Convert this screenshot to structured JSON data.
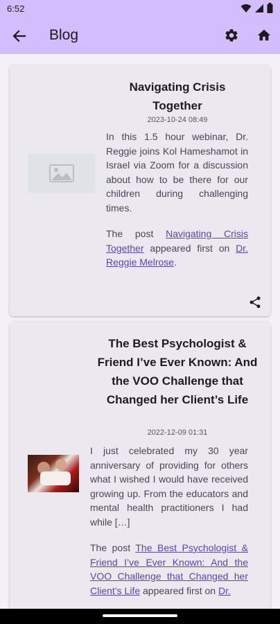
{
  "status_bar": {
    "time": "6:52"
  },
  "app_bar": {
    "title": "Blog"
  },
  "posts": [
    {
      "title": "Navigating Crisis Together",
      "date": "2023-10-24 08:49",
      "excerpt": "In this 1.5 hour webinar, Dr. Reggie joins Kol Hameshamot in Israel via Zoom for a discussion about how to be there for our children during challenging times.",
      "footer_prefix": "The post",
      "footer_link_post": "Navigating Crisis Together",
      "footer_middle": "appeared first on",
      "footer_link_site": "Dr. Reggie Melrose",
      "footer_suffix": ".",
      "thumbnail": "image-placeholder-icon"
    },
    {
      "title": "The Best Psychologist & Friend I’ve Ever Known: And the VOO Challenge that Changed her Client’s Life",
      "date": "2022-12-09 01:31",
      "excerpt": "I just celebrated my 30 year anniversary of providing for others what I wished I would have received growing up. From the educators and mental health practitioners I had while […]",
      "footer_prefix": "The post",
      "footer_link_post": "The Best Psychologist & Friend I’ve Ever Known: And the VOO Challenge that Changed her Client’s Life",
      "footer_middle": "appeared first on",
      "footer_link_site": "Dr.",
      "thumbnail": "photo"
    }
  ],
  "colors": {
    "app_bar": "#d3bdfc",
    "background": "#f4f0f7",
    "card": "#ece8f0",
    "link": "#5b45a8"
  }
}
